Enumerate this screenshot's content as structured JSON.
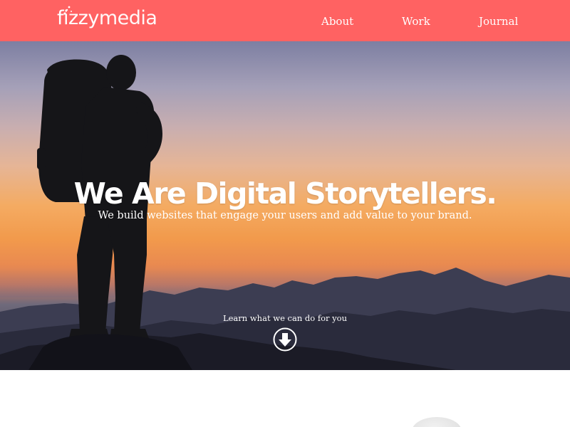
{
  "header": {
    "logo": {
      "part1": "fizzy",
      "part2": "media"
    },
    "nav": [
      {
        "label": "About"
      },
      {
        "label": "Work"
      },
      {
        "label": "Journal"
      }
    ],
    "colors": {
      "header_bg": "#ff6262",
      "text": "#ffffff"
    }
  },
  "hero": {
    "title": "We Are Digital Storytellers.",
    "subtitle": "We build websites that engage your users and add value to your brand.",
    "cta": "Learn what we can do for you",
    "scroll_icon": "arrow-down-circle-icon",
    "image": "hiker-silhouette-at-sunset-mountains"
  }
}
